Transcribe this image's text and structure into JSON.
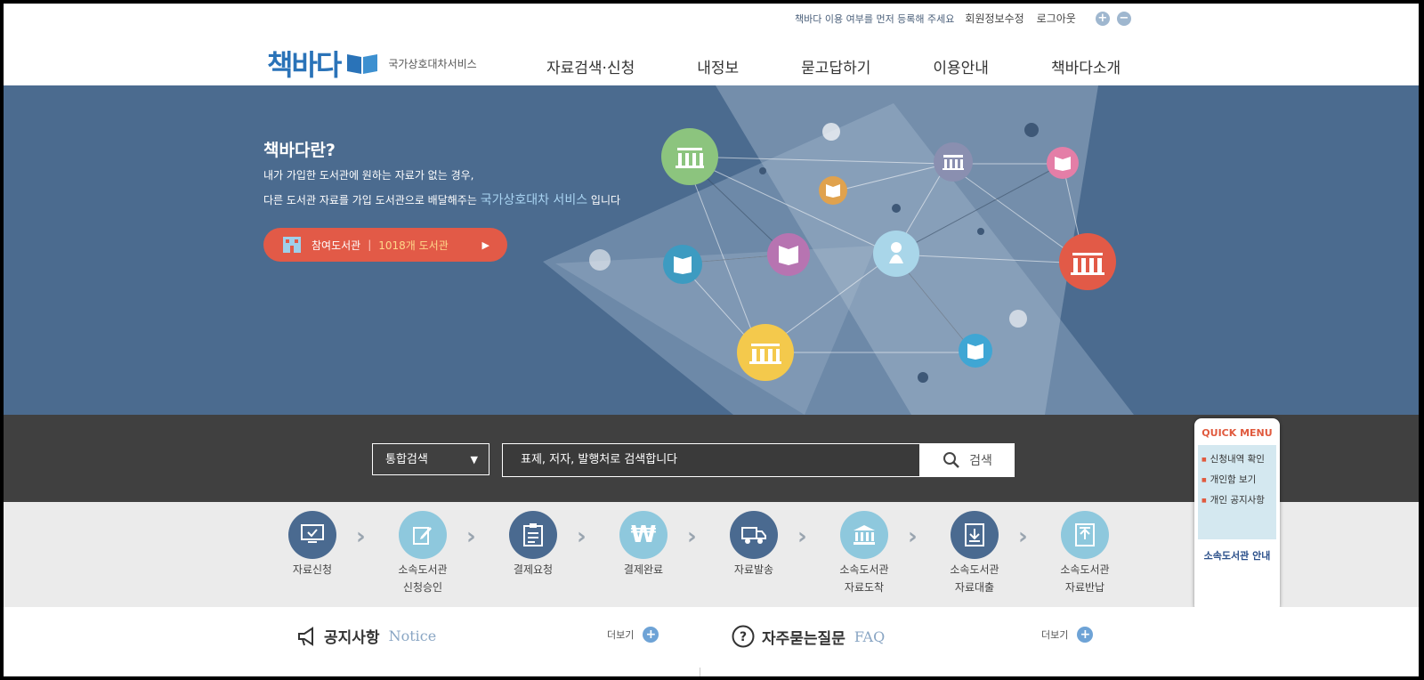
{
  "header": {
    "top_notice": "책바다 이용 여부를 먼저 등록해 주세요",
    "member_edit": "회원정보수정",
    "logout": "로그아웃",
    "zoom_in": "+",
    "zoom_out": "−",
    "logo_text": "책바다",
    "logo_sub": "국가상호대차서비스"
  },
  "nav": [
    "자료검색·신청",
    "내정보",
    "묻고답하기",
    "이용안내",
    "책바다소개"
  ],
  "hero": {
    "title": "책바다란?",
    "desc1": "내가 가입한 도서관에 원하는 자료가 없는 경우,",
    "desc2_pre": "다른 도서관 자료를 가입 도서관으로 배달해주는",
    "desc2_hl": "국가상호대차 서비스",
    "desc2_post": "입니다",
    "library_btn_label": "참여도서관",
    "library_btn_sep": "|",
    "library_btn_count": "1018개 도서관",
    "library_btn_play": "▶"
  },
  "search": {
    "select_value": "통합검색",
    "caret": "▼",
    "placeholder": "표제, 저자, 발행처로 검색합니다",
    "button": "검색"
  },
  "process": [
    {
      "line1": "자료신청",
      "line2": "",
      "icon": "monitor-check-icon",
      "tone": "dark"
    },
    {
      "line1": "소속도서관",
      "line2": "신청승인",
      "icon": "edit-icon",
      "tone": "light"
    },
    {
      "line1": "결제요청",
      "line2": "",
      "icon": "clipboard-icon",
      "tone": "dark"
    },
    {
      "line1": "결제완료",
      "line2": "",
      "icon": "won-icon",
      "tone": "light"
    },
    {
      "line1": "자료발송",
      "line2": "",
      "icon": "truck-icon",
      "tone": "dark"
    },
    {
      "line1": "소속도서관",
      "line2": "자료도착",
      "icon": "library-icon",
      "tone": "light"
    },
    {
      "line1": "소속도서관",
      "line2": "자료대출",
      "icon": "download-box-icon",
      "tone": "dark"
    },
    {
      "line1": "소속도서관",
      "line2": "자료반납",
      "icon": "upload-box-icon",
      "tone": "light"
    }
  ],
  "quick_menu": {
    "title": "QUICK MENU",
    "items": [
      "신청내역 확인",
      "개인함 보기",
      "개인 공지사항"
    ],
    "footer": "소속도서관 안내"
  },
  "boards": {
    "notice_title": "공지사항",
    "notice_en": "Notice",
    "faq_title": "자주묻는질문",
    "faq_en": "FAQ",
    "more": "더보기",
    "plus": "+"
  },
  "colors": {
    "hero_bg": "#4b6b8f",
    "accent_red": "#e25a47",
    "search_bg": "#404040",
    "process_bg": "#ebebeb",
    "logo_blue": "#2a73b8"
  }
}
